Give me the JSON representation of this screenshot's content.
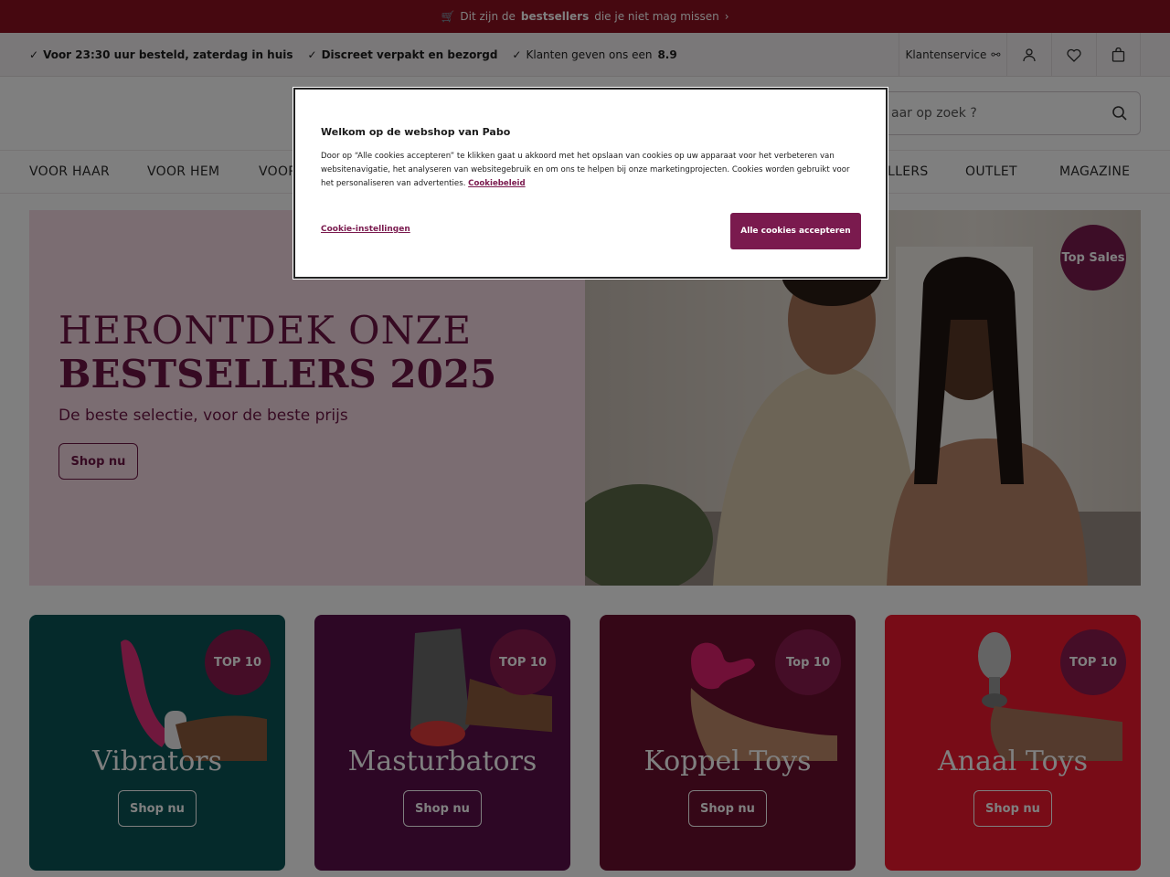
{
  "promo": {
    "text_before": "Dit zijn de",
    "highlight": "bestsellers",
    "text_after": "die je niet mag missen",
    "icon": "cart-icon"
  },
  "usps": [
    "Voor 23:30 uur besteld, zaterdag in huis",
    "Discreet verpakt en bezorgd",
    "Klanten geven ons een"
  ],
  "rating": "8.9",
  "header_actions": {
    "service_label": "Klantenservice"
  },
  "search": {
    "placeholder": "aar op zoek ?"
  },
  "nav": [
    "VOOR HAAR",
    "VOOR HEM",
    "VOOR",
    "LLERS",
    "OUTLET",
    "MAGAZINE"
  ],
  "hero": {
    "title_line1": "HERONTDEK ONZE",
    "title_line2": "BESTSELLERS 2025",
    "subtitle": "De beste selectie, voor de beste prijs",
    "cta": "Shop nu",
    "badge": "Top Sales"
  },
  "cards": [
    {
      "title": "Vibrators",
      "badge": "TOP 10",
      "cta": "Shop nu",
      "bg": "#0b5556",
      "badge_bg": "#8a1a4e"
    },
    {
      "title": "Masturbators",
      "badge": "TOP 10",
      "cta": "Shop nu",
      "bg": "#5a0f4a",
      "badge_bg": "#8a1a4e"
    },
    {
      "title": "Koppel Toys",
      "badge": "Top 10",
      "cta": "Shop nu",
      "bg": "#6a0f2e",
      "badge_bg": "#8a1a4e"
    },
    {
      "title": "Anaal Toys",
      "badge": "TOP 10",
      "cta": "Shop nu",
      "bg": "#f0192e",
      "badge_bg": "#8a1a4e"
    }
  ],
  "cookie": {
    "title": "Welkom op de webshop van Pabo",
    "body": "Door op “Alle cookies accepteren” te klikken gaat u akkoord met het opslaan van cookies op uw apparaat voor het verbeteren van websitenavigatie, het analyseren van websitegebruik en om ons te helpen bij onze marketingprojecten. Cookies worden gebruikt voor het personaliseren van advertenties.",
    "policy_link": "Cookiebeleid",
    "settings_label": "Cookie-instellingen",
    "accept_label": "Alle cookies accepteren"
  }
}
